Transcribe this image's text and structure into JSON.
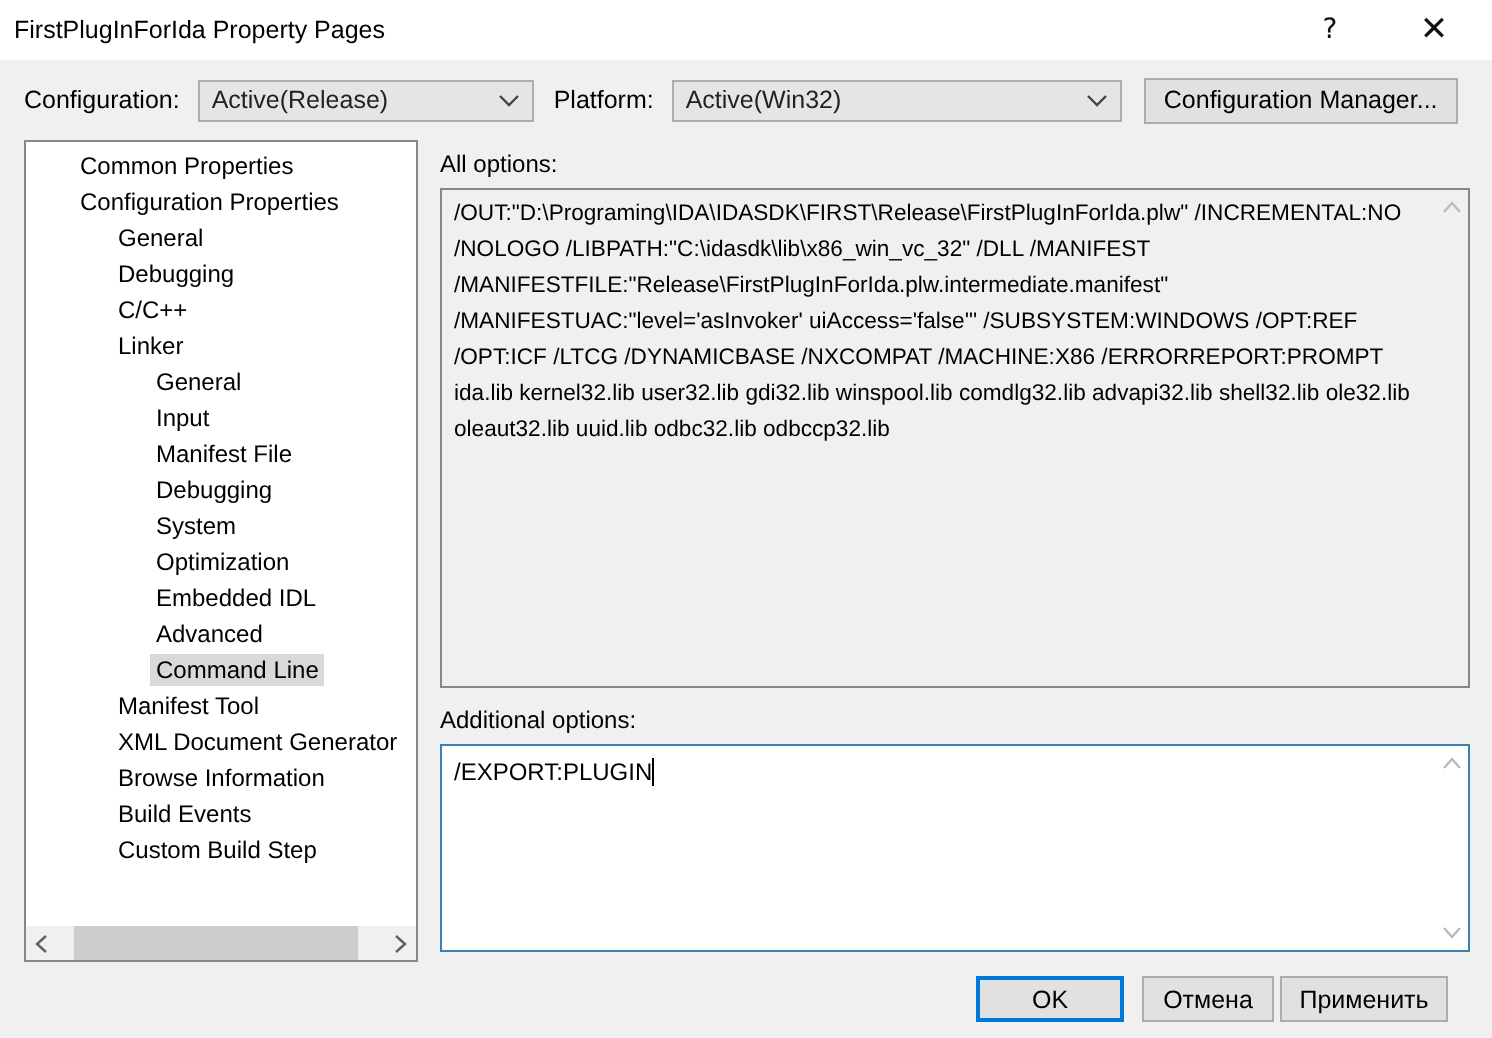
{
  "window": {
    "title": "FirstPlugInForIda Property Pages",
    "buttons": [
      "?",
      "✕"
    ]
  },
  "configuration": {
    "label": "Configuration:",
    "value": "Active(Release)"
  },
  "platform": {
    "label": "Platform:",
    "value": "Active(Win32)"
  },
  "configuration_manager": {
    "label": "Configuration Manager..."
  },
  "tree": [
    {
      "label": "Common Properties",
      "selected": false
    },
    {
      "label": "Configuration Properties",
      "selected": false,
      "children": [
        {
          "label": "General",
          "selected": false
        },
        {
          "label": "Debugging",
          "selected": false
        },
        {
          "label": "C/C++",
          "selected": false
        },
        {
          "label": "Linker",
          "selected": false,
          "children": [
            {
              "label": "General",
              "selected": false
            },
            {
              "label": "Input",
              "selected": false
            },
            {
              "label": "Manifest File",
              "selected": false
            },
            {
              "label": "Debugging",
              "selected": false
            },
            {
              "label": "System",
              "selected": false
            },
            {
              "label": "Optimization",
              "selected": false
            },
            {
              "label": "Embedded IDL",
              "selected": false
            },
            {
              "label": "Advanced",
              "selected": false
            },
            {
              "label": "Command Line",
              "selected": true
            }
          ]
        },
        {
          "label": "Manifest Tool",
          "selected": false
        },
        {
          "label": "XML Document Generator",
          "selected": false
        },
        {
          "label": "Browse Information",
          "selected": false
        },
        {
          "label": "Build Events",
          "selected": false
        },
        {
          "label": "Custom Build Step",
          "selected": false
        }
      ]
    }
  ],
  "all_options": {
    "label": "All options:",
    "value": "/OUT:\"D:\\Programing\\IDA\\IDASDK\\FIRST\\Release\\FirstPlugInForIda.plw\" /INCREMENTAL:NO /NOLOGO /LIBPATH:\"C:\\idasdk\\lib\\x86_win_vc_32\" /DLL /MANIFEST /MANIFESTFILE:\"Release\\FirstPlugInForIda.plw.intermediate.manifest\" /MANIFESTUAC:\"level='asInvoker' uiAccess='false'\" /SUBSYSTEM:WINDOWS /OPT:REF /OPT:ICF /LTCG /DYNAMICBASE /NXCOMPAT /MACHINE:X86 /ERRORREPORT:PROMPT ida.lib  kernel32.lib user32.lib gdi32.lib winspool.lib comdlg32.lib advapi32.lib shell32.lib ole32.lib oleaut32.lib uuid.lib odbc32.lib odbccp32.lib"
  },
  "additional_options": {
    "label": "Additional options:",
    "value": "/EXPORT:PLUGIN"
  },
  "buttons": [
    {
      "label": "OK",
      "default": true
    },
    {
      "label": "Отмена",
      "default": false
    },
    {
      "label": "Применить",
      "default": false
    }
  ]
}
